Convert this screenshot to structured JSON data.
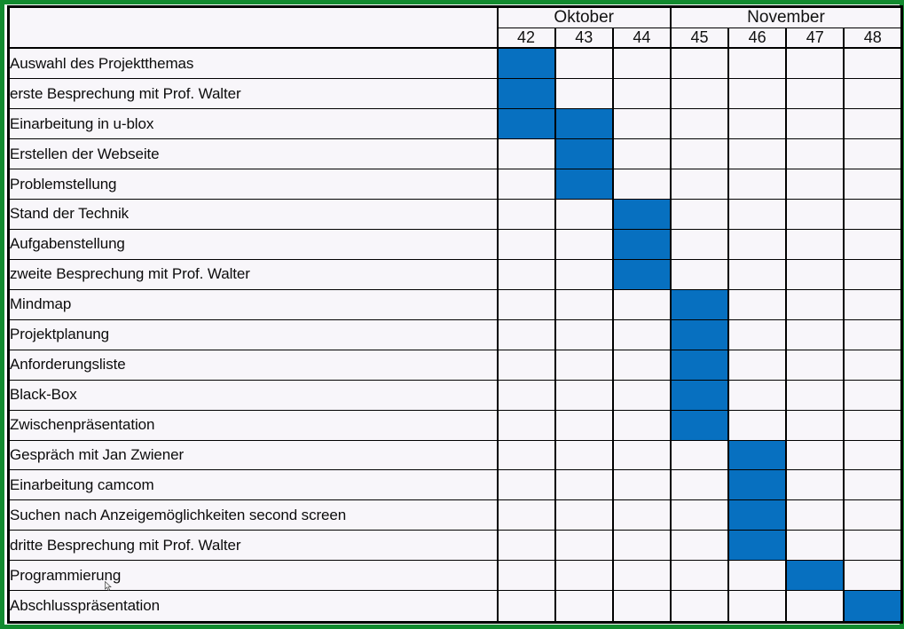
{
  "chart_data": {
    "type": "bar",
    "title": "",
    "xlabel": "",
    "ylabel": "",
    "orientation": "horizontal",
    "grid": true,
    "legend": "none",
    "months": [
      {
        "name": "Oktober",
        "weeks": [
          "42",
          "43",
          "44"
        ]
      },
      {
        "name": "November",
        "weeks": [
          "45",
          "46",
          "47",
          "48"
        ]
      }
    ],
    "week_columns": [
      "42",
      "43",
      "44",
      "45",
      "46",
      "47",
      "48"
    ],
    "bar_color": "#0770c0",
    "frame_color": "#128a2f",
    "cell_background": "#f8f6fa",
    "grid_color": "#000000",
    "tasks": [
      {
        "label": "Auswahl des Projektthemas",
        "start_week": "42",
        "end_week": "42",
        "filled": [
          1,
          0,
          0,
          0,
          0,
          0,
          0
        ]
      },
      {
        "label": "erste Besprechung mit Prof. Walter",
        "start_week": "42",
        "end_week": "42",
        "filled": [
          1,
          0,
          0,
          0,
          0,
          0,
          0
        ]
      },
      {
        "label": "Einarbeitung in u-blox",
        "start_week": "42",
        "end_week": "43",
        "filled": [
          1,
          1,
          0,
          0,
          0,
          0,
          0
        ]
      },
      {
        "label": "Erstellen der Webseite",
        "start_week": "43",
        "end_week": "43",
        "filled": [
          0,
          1,
          0,
          0,
          0,
          0,
          0
        ]
      },
      {
        "label": "Problemstellung",
        "start_week": "43",
        "end_week": "43",
        "filled": [
          0,
          1,
          0,
          0,
          0,
          0,
          0
        ]
      },
      {
        "label": "Stand der Technik",
        "start_week": "44",
        "end_week": "44",
        "filled": [
          0,
          0,
          1,
          0,
          0,
          0,
          0
        ]
      },
      {
        "label": "Aufgabenstellung",
        "start_week": "44",
        "end_week": "44",
        "filled": [
          0,
          0,
          1,
          0,
          0,
          0,
          0
        ]
      },
      {
        "label": "zweite Besprechung mit Prof. Walter",
        "start_week": "44",
        "end_week": "44",
        "filled": [
          0,
          0,
          1,
          0,
          0,
          0,
          0
        ]
      },
      {
        "label": "Mindmap",
        "start_week": "45",
        "end_week": "45",
        "filled": [
          0,
          0,
          0,
          1,
          0,
          0,
          0
        ]
      },
      {
        "label": "Projektplanung",
        "start_week": "45",
        "end_week": "45",
        "filled": [
          0,
          0,
          0,
          1,
          0,
          0,
          0
        ]
      },
      {
        "label": "Anforderungsliste",
        "start_week": "45",
        "end_week": "45",
        "filled": [
          0,
          0,
          0,
          1,
          0,
          0,
          0
        ]
      },
      {
        "label": "Black-Box",
        "start_week": "45",
        "end_week": "45",
        "filled": [
          0,
          0,
          0,
          1,
          0,
          0,
          0
        ]
      },
      {
        "label": "Zwischenpräsentation",
        "start_week": "45",
        "end_week": "45",
        "filled": [
          0,
          0,
          0,
          1,
          0,
          0,
          0
        ]
      },
      {
        "label": "Gespräch mit Jan Zwiener",
        "start_week": "46",
        "end_week": "46",
        "filled": [
          0,
          0,
          0,
          0,
          1,
          0,
          0
        ]
      },
      {
        "label": "Einarbeitung camcom",
        "start_week": "46",
        "end_week": "46",
        "filled": [
          0,
          0,
          0,
          0,
          1,
          0,
          0
        ]
      },
      {
        "label": "Suchen nach Anzeigemöglichkeiten second screen",
        "start_week": "46",
        "end_week": "46",
        "filled": [
          0,
          0,
          0,
          0,
          1,
          0,
          0
        ]
      },
      {
        "label": "dritte Besprechung mit Prof. Walter",
        "start_week": "46",
        "end_week": "46",
        "filled": [
          0,
          0,
          0,
          0,
          1,
          0,
          0
        ]
      },
      {
        "label": "Programmierung",
        "start_week": "47",
        "end_week": "47",
        "filled": [
          0,
          0,
          0,
          0,
          0,
          1,
          0
        ]
      },
      {
        "label": "Abschlusspräsentation",
        "start_week": "48",
        "end_week": "48",
        "filled": [
          0,
          0,
          0,
          0,
          0,
          0,
          1
        ]
      }
    ]
  }
}
